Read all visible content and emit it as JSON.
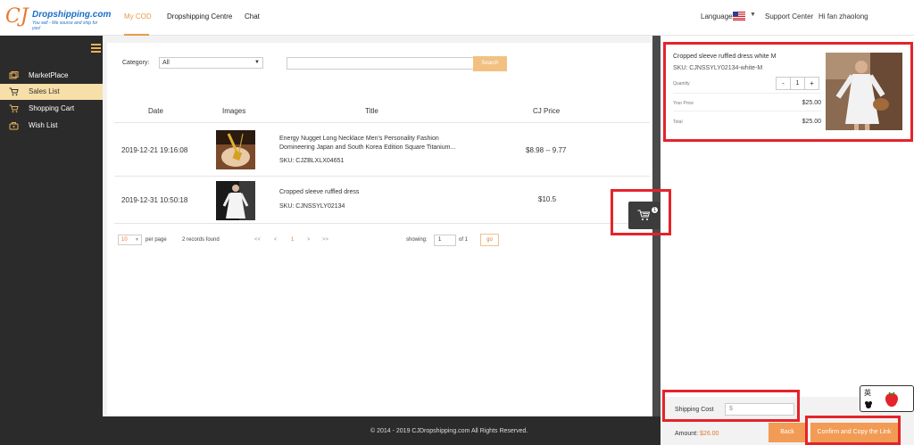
{
  "header": {
    "logo_mark": "CJ",
    "logo_name": "Dropshipping.com",
    "logo_tagline": "You sell - We source and ship for you!",
    "nav": [
      {
        "label": "My COD",
        "active": true
      },
      {
        "label": "Dropshipping Centre",
        "active": false
      },
      {
        "label": "Chat",
        "active": false
      }
    ],
    "language_label": "Language",
    "support_label": "Support Center",
    "greeting": "Hi fan zhaolong"
  },
  "sidebar": {
    "items": [
      {
        "label": "MarketPlace",
        "icon": "marketplace-icon",
        "active": false
      },
      {
        "label": "Sales List",
        "icon": "cart-icon",
        "active": true
      },
      {
        "label": "Shopping Cart",
        "icon": "shopping-cart-icon",
        "active": false
      },
      {
        "label": "Wish List",
        "icon": "wish-list-icon",
        "active": false
      }
    ]
  },
  "filters": {
    "category_label": "Category:",
    "category_value": "All",
    "search_value": "",
    "search_button": "Search"
  },
  "table": {
    "columns": [
      "Date",
      "Images",
      "Title",
      "CJ Price"
    ],
    "rows": [
      {
        "date": "2019-12-21 19:16:08",
        "title_line1": "Energy Nugget Long Necklace Men's Personality Fashion",
        "title_line2": "Domineering Japan and South Korea Edition Square Titanium...",
        "sku": "SKU: CJZBLXLX04651",
        "price": "$8.98 -- 9.77"
      },
      {
        "date": "2019-12-31 10:50:18",
        "title_line1": "Cropped sleeve ruffled dress",
        "title_line2": "",
        "sku": "SKU: CJNSSYLY02134",
        "price": "$10.5"
      }
    ]
  },
  "pager": {
    "page_size": "10",
    "per_page_label": "per page",
    "records_found": "2 records found",
    "first": "<<",
    "prev": "<",
    "current": "1",
    "next": ">",
    "last": ">>",
    "showing_label": "showing:",
    "goto_value": "1",
    "of_label": "of 1",
    "go_label": "go"
  },
  "cart_float": {
    "badge": "1"
  },
  "footer": {
    "text": "© 2014 - 2019 CJDropshipping.com All Rights Reserved."
  },
  "checkout": {
    "item_title": "Cropped sleeve ruffled dress white M",
    "item_sku": "SKU: CJNSSYLY02134-white-M",
    "quantity_label": "Quantity",
    "qty_minus": "-",
    "qty_value": "1",
    "qty_plus": "+",
    "your_price_label": "Your Price",
    "your_price": "$25.00",
    "total_label": "Total",
    "total": "$25.00",
    "shipping_label": "Shipping Cost",
    "shipping_prefix": "$",
    "amount_label": "Amount:",
    "amount_value": "$26.00",
    "back_button": "Back",
    "confirm_button": "Confirm and Copy the Link"
  },
  "widget": {
    "char": "英"
  },
  "colors": {
    "accent": "#e89b4a",
    "button": "#f29b55",
    "sidebar_bg": "#2b2b2b",
    "highlight": "#e5232a"
  }
}
